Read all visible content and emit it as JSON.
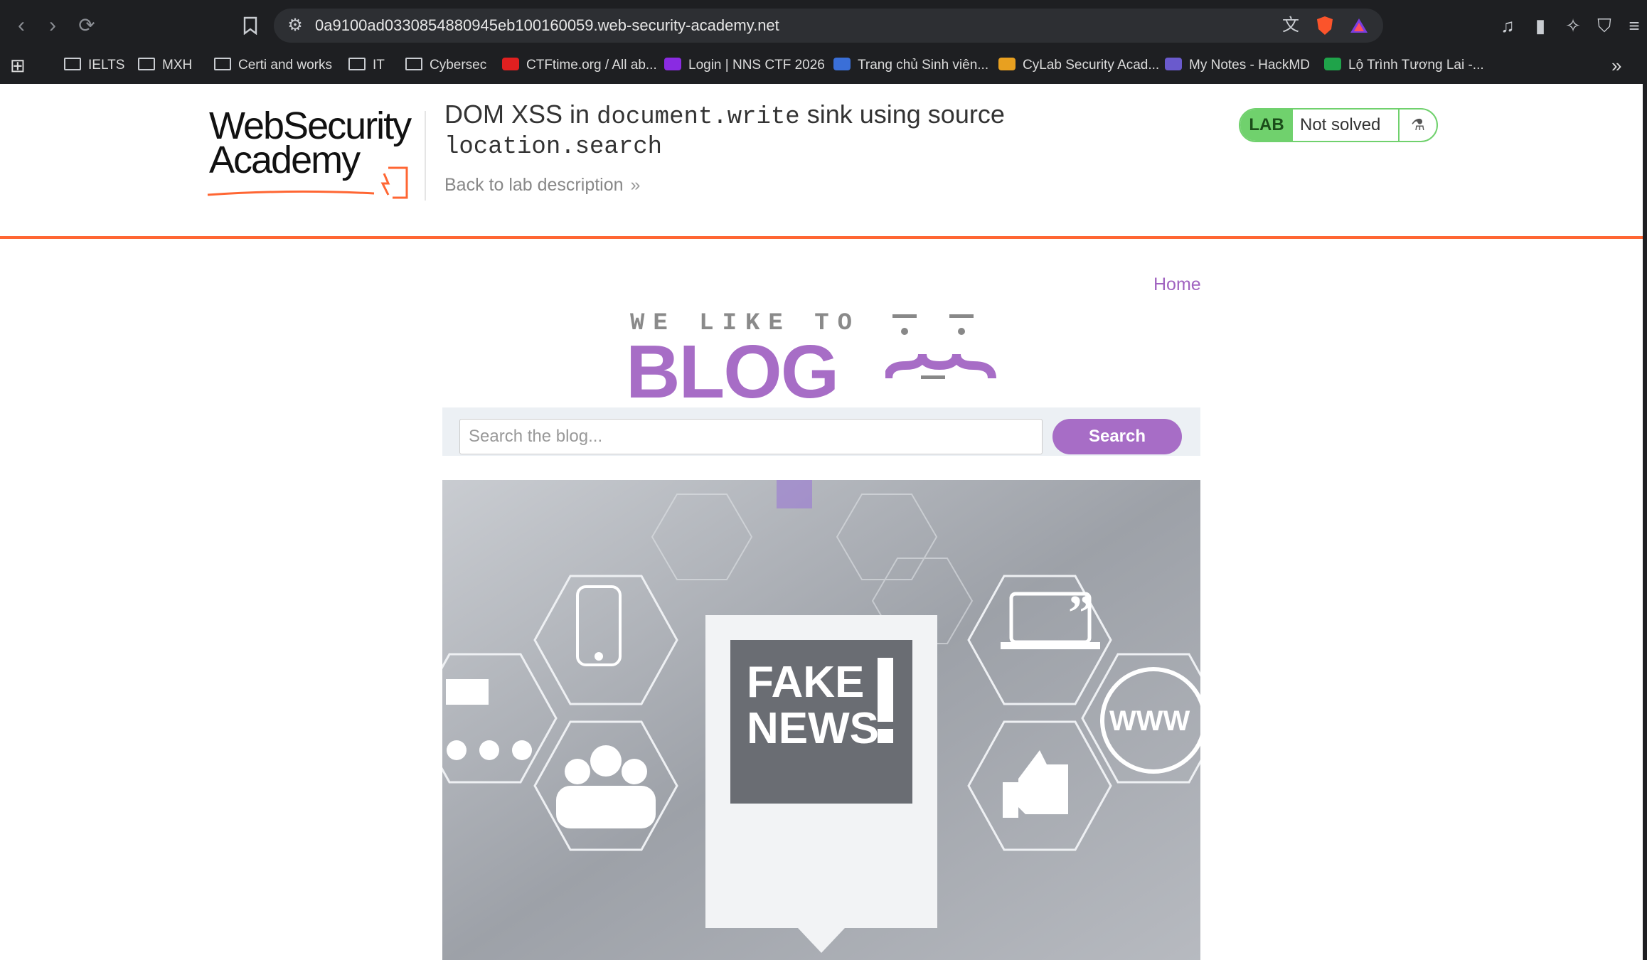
{
  "browser": {
    "url": "0a9100ad0330854880945eb100160059.web-security-academy.net",
    "bookmarks": [
      {
        "label": "IELTS",
        "type": "folder"
      },
      {
        "label": "MXH",
        "type": "folder"
      },
      {
        "label": "Certi and works",
        "type": "folder"
      },
      {
        "label": "IT",
        "type": "folder"
      },
      {
        "label": "Cybersec",
        "type": "folder"
      },
      {
        "label": "CTFtime.org / All ab...",
        "type": "site",
        "color": "#e02020"
      },
      {
        "label": "Login | NNS CTF 2026",
        "type": "site",
        "color": "#8a2be2"
      },
      {
        "label": "Trang chủ Sinh viên...",
        "type": "site",
        "color": "#3a6fd8"
      },
      {
        "label": "CyLab Security Acad...",
        "type": "site",
        "color": "#e8a020"
      },
      {
        "label": "My Notes - HackMD",
        "type": "site",
        "color": "#6a5acd"
      },
      {
        "label": "Lộ Trình Tương Lai -...",
        "type": "site",
        "color": "#1fa34a"
      }
    ]
  },
  "lab": {
    "logo_line1": "WebSecurity",
    "logo_line2": "Academy",
    "title_prefix": "DOM XSS in ",
    "title_code1": "document.write",
    "title_mid": " sink using source",
    "title_code2": "location.search",
    "back_link": "Back to lab description",
    "status_label": "LAB",
    "status_text": "Not solved"
  },
  "blog": {
    "nav_home": "Home",
    "banner_top": "WE LIKE TO",
    "banner_main": "BLOG",
    "search_placeholder": "Search the blog...",
    "search_button": "Search",
    "image_text": "FAKE NEWS!",
    "image_web_text": "WWW"
  },
  "colors": {
    "accent_purple": "#a76dc6",
    "lab_green": "#70d16d",
    "header_orange": "#ff6633"
  }
}
